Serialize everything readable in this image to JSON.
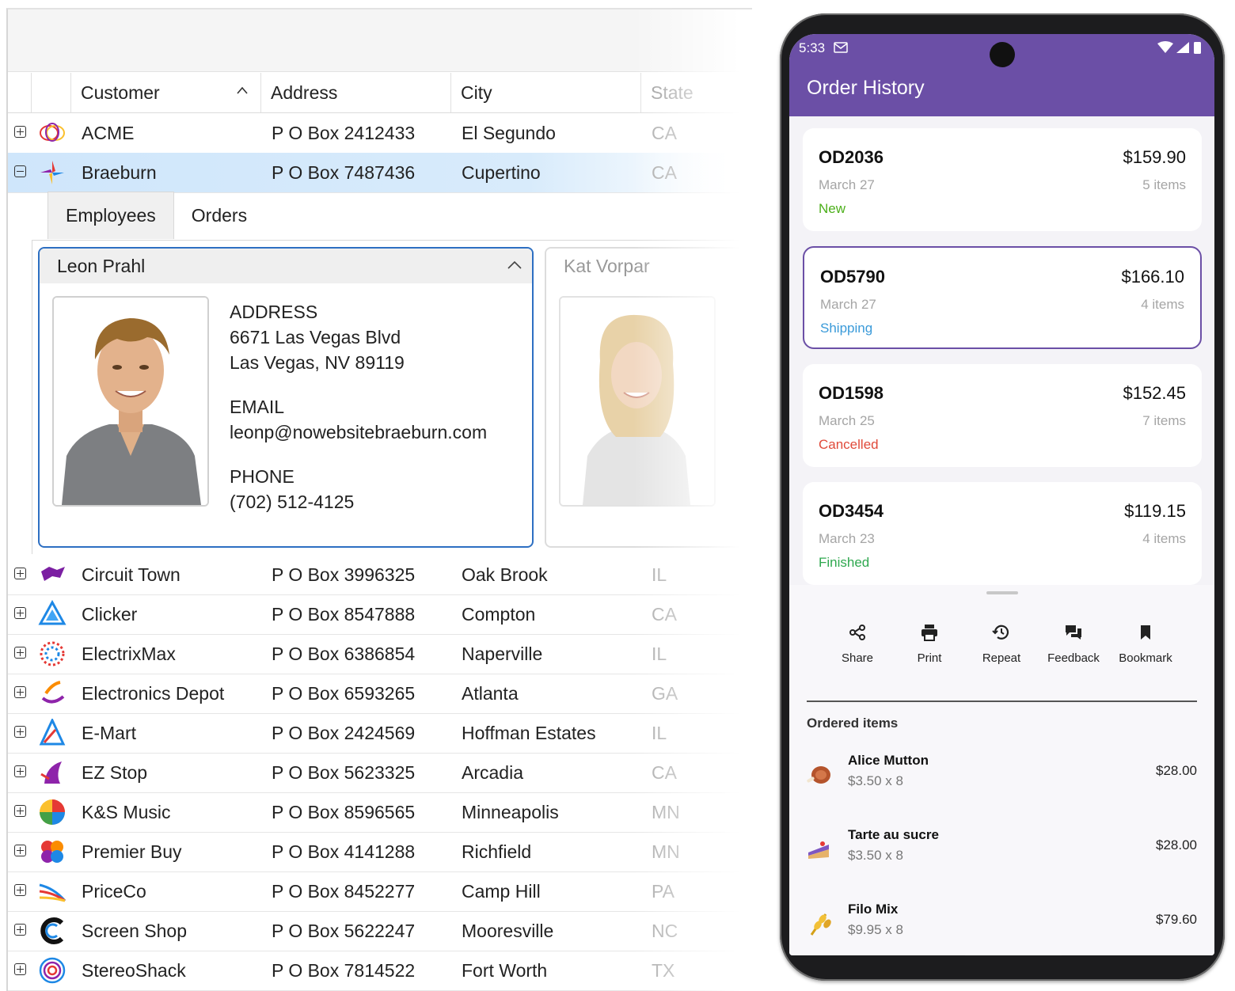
{
  "grid": {
    "columns": [
      "Customer",
      "Address",
      "City",
      "State"
    ],
    "rows_top": [
      {
        "name": "ACME",
        "address": "P O Box 2412433",
        "city": "El Segundo",
        "state": "CA"
      },
      {
        "name": "Braeburn",
        "address": "P O Box 7487436",
        "city": "Cupertino",
        "state": "CA"
      }
    ],
    "rows_bottom": [
      {
        "name": "Circuit Town",
        "address": "P O Box 3996325",
        "city": "Oak Brook",
        "state": "IL"
      },
      {
        "name": "Clicker",
        "address": "P O Box 8547888",
        "city": "Compton",
        "state": "CA"
      },
      {
        "name": "ElectrixMax",
        "address": "P O Box 6386854",
        "city": "Naperville",
        "state": "IL"
      },
      {
        "name": "Electronics Depot",
        "address": "P O Box 6593265",
        "city": "Atlanta",
        "state": "GA"
      },
      {
        "name": "E-Mart",
        "address": "P O Box 2424569",
        "city": "Hoffman Estates",
        "state": "IL"
      },
      {
        "name": "EZ Stop",
        "address": "P O Box 5623325",
        "city": "Arcadia",
        "state": "CA"
      },
      {
        "name": "K&S Music",
        "address": "P O Box 8596565",
        "city": "Minneapolis",
        "state": "MN"
      },
      {
        "name": "Premier Buy",
        "address": "P O Box 4141288",
        "city": "Richfield",
        "state": "MN"
      },
      {
        "name": "PriceCo",
        "address": "P O Box 8452277",
        "city": "Camp Hill",
        "state": "PA"
      },
      {
        "name": "Screen Shop",
        "address": "P O Box 5622247",
        "city": "Mooresville",
        "state": "NC"
      },
      {
        "name": "StereoShack",
        "address": "P O Box 7814522",
        "city": "Fort Worth",
        "state": "TX"
      }
    ],
    "detail": {
      "tabs": [
        "Employees",
        "Orders"
      ],
      "employee": {
        "name": "Leon Prahl",
        "address_label": "ADDRESS",
        "address_line1": "6671 Las Vegas Blvd",
        "address_line2": "Las Vegas, NV 89119",
        "email_label": "EMAIL",
        "email": "leonp@nowebsitebraeburn.com",
        "phone_label": "PHONE",
        "phone": "(702) 512-4125"
      },
      "employee2": {
        "name": "Kat Vorpar"
      }
    }
  },
  "phone": {
    "status_time": "5:33",
    "title": "Order History",
    "orders": [
      {
        "id": "OD2036",
        "total": "$159.90",
        "date": "March 27",
        "items": "5 items",
        "status": "New",
        "status_color": "#4caf1a"
      },
      {
        "id": "OD5790",
        "total": "$166.10",
        "date": "March 27",
        "items": "4 items",
        "status": "Shipping",
        "status_color": "#3a9ad9"
      },
      {
        "id": "OD1598",
        "total": "$152.45",
        "date": "March 25",
        "items": "7 items",
        "status": "Cancelled",
        "status_color": "#e04a3a"
      },
      {
        "id": "OD3454",
        "total": "$119.15",
        "date": "March 23",
        "items": "4 items",
        "status": "Finished",
        "status_color": "#2fa84f"
      }
    ],
    "actions": [
      {
        "label": "Share",
        "icon": "share-icon"
      },
      {
        "label": "Print",
        "icon": "print-icon"
      },
      {
        "label": "Repeat",
        "icon": "history-icon"
      },
      {
        "label": "Feedback",
        "icon": "feedback-icon"
      },
      {
        "label": "Bookmark",
        "icon": "bookmark-icon"
      }
    ],
    "ordered_items_title": "Ordered items",
    "items": [
      {
        "name": "Alice Mutton",
        "qty": "$3.50 x 8",
        "price": "$28.00",
        "icon": "meat-icon"
      },
      {
        "name": "Tarte au sucre",
        "qty": "$3.50 x 8",
        "price": "$28.00",
        "icon": "cake-icon"
      },
      {
        "name": "Filo Mix",
        "qty": "$9.95 x 8",
        "price": "$79.60",
        "icon": "grain-icon"
      }
    ],
    "accent": "#6b4fa6"
  }
}
